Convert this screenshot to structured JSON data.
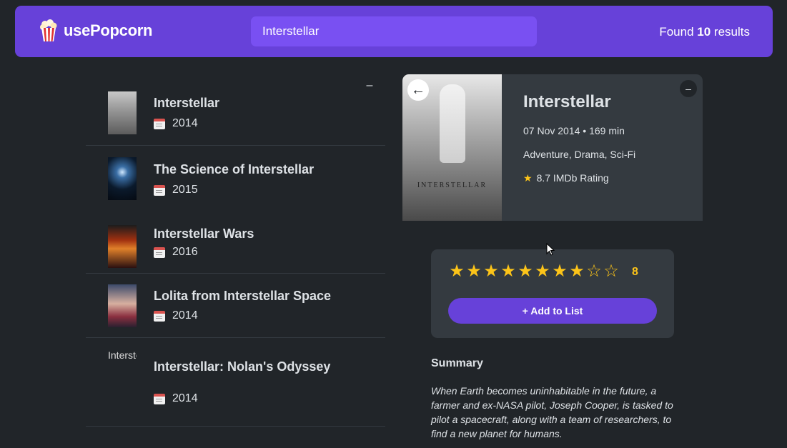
{
  "nav": {
    "logo_text": "usePopcorn",
    "search_value": "Interstellar",
    "found_prefix": "Found",
    "found_count": "10",
    "found_suffix": "results"
  },
  "list": {
    "toggle_label": "–",
    "movies": [
      {
        "title": "Interstellar",
        "year": "2014"
      },
      {
        "title": "The Science of Interstellar",
        "year": "2015"
      },
      {
        "title": "Interstellar Wars",
        "year": "2016"
      },
      {
        "title": "Lolita from Interstellar Space",
        "year": "2014"
      },
      {
        "title": "Interstellar: Nolan's Odyssey",
        "year": "2014",
        "poster_alt": "Interstellar: Nolan's Odyssey poster"
      }
    ]
  },
  "details": {
    "back_label": "←",
    "close_label": "–",
    "title": "Interstellar",
    "release_runtime": "07 Nov 2014 • 169 min",
    "genres": "Adventure, Drama, Sci-Fi",
    "imdb_rating": "8.7 IMDb Rating",
    "poster_title": "INTERSTELLAR"
  },
  "rating": {
    "value": 8,
    "max": 10,
    "display": "8",
    "add_button": "+ Add to List"
  },
  "summary": {
    "heading": "Summary",
    "text": "When Earth becomes uninhabitable in the future, a farmer and ex-NASA pilot, Joseph Cooper, is tasked to pilot a spacecraft, along with a team of researchers, to find a new planet for humans."
  },
  "colors": {
    "background": "#212529",
    "nav": "#6741d9",
    "search": "#7950f2",
    "panel": "#343a40",
    "star": "#fcc419"
  }
}
